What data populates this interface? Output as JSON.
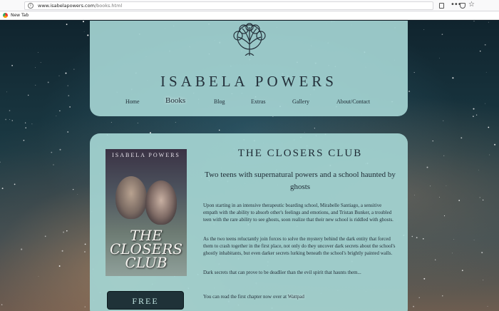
{
  "browser": {
    "url_host": "www.isabelapowers.com",
    "url_path": "/books.html",
    "tab_label": "New Tab"
  },
  "site": {
    "title": "ISABELA POWERS",
    "nav": [
      "Home",
      "Books",
      "Blog",
      "Extras",
      "Gallery",
      "About/Contact"
    ],
    "active_nav": "Books"
  },
  "book": {
    "cover_author": "ISABELA POWERS",
    "cover_title_line1": "THE",
    "cover_title_line2": "CLOSERS",
    "cover_title_line3": "CLUB",
    "title": "THE CLOSERS CLUB",
    "tagline": "Two teens with supernatural powers and a school haunted by ghosts",
    "paragraphs": [
      "Upon starting in an intensive therapeutic boarding school, Mirabelle Santiago, a sensitive empath with the ability to absorb other's feelings and emotions, and Tristan Bunker, a troubled teen with the rare ability to see ghosts, soon realize that their new school is riddled with ghosts.",
      "As the two teens reluctantly join forces to solve the mystery behind the dark entity that forced them to crash together in the first place, not only do they uncover dark secrets about the school's ghostly inhabitants, but even darker secrets lurking beneath the school's brightly painted walls.",
      "Dark secrets that can prove to be deadlier than the evil spirit that haunts them..."
    ],
    "chapter_text": "You can read the first chapter now over at ",
    "chapter_link": "Wattpad",
    "free_button": "FREE"
  },
  "colors": {
    "panel": "#a4d4d2",
    "text": "#1e2a34",
    "button": "#1f3238"
  }
}
